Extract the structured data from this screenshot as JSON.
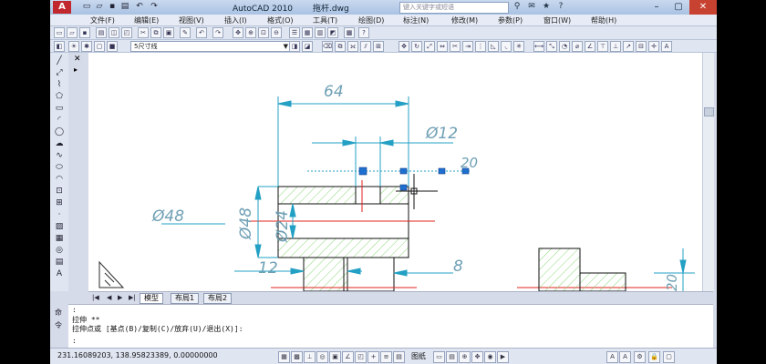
{
  "window": {
    "app_title": "AutoCAD 2010",
    "file_name": "拖杆.dwg",
    "search_placeholder": "键入关键字或短语",
    "logo": "A"
  },
  "menu": [
    {
      "label": "文件(F)"
    },
    {
      "label": "编辑(E)"
    },
    {
      "label": "视图(V)"
    },
    {
      "label": "插入(I)"
    },
    {
      "label": "格式(O)"
    },
    {
      "label": "工具(T)"
    },
    {
      "label": "绘图(D)"
    },
    {
      "label": "标注(N)"
    },
    {
      "label": "修改(M)"
    },
    {
      "label": "参数(P)"
    },
    {
      "label": "窗口(W)"
    },
    {
      "label": "帮助(H)"
    }
  ],
  "layer": {
    "current": "5尺寸线"
  },
  "drawing": {
    "dim_64": "64",
    "dim_d12": "Ø12",
    "dim_20_top": "20",
    "dim_d48_leader": "Ø48",
    "dim_d48": "Ø48",
    "dim_d24": "Ø24",
    "dim_12": "12",
    "dim_8": "8",
    "dim_20_right": "20"
  },
  "tabs": {
    "model": "模型",
    "layout1": "布局1",
    "layout2": "布局2"
  },
  "command": {
    "line1": ":",
    "line2": "拉伸 **",
    "line3": "拉伸点或 [基点(B)/复制(C)/放弃(U)/退出(X)]:",
    "line4": ":",
    "side_label1": "命",
    "side_label2": "令"
  },
  "status": {
    "coords": "231.16089203, 138.95823389, 0.00000000",
    "paper": "图纸"
  },
  "colors": {
    "dimension": "#23a0c4",
    "hatch": "#7fd36a",
    "center_line": "#e0231e",
    "grip": "#1f6fd0"
  }
}
